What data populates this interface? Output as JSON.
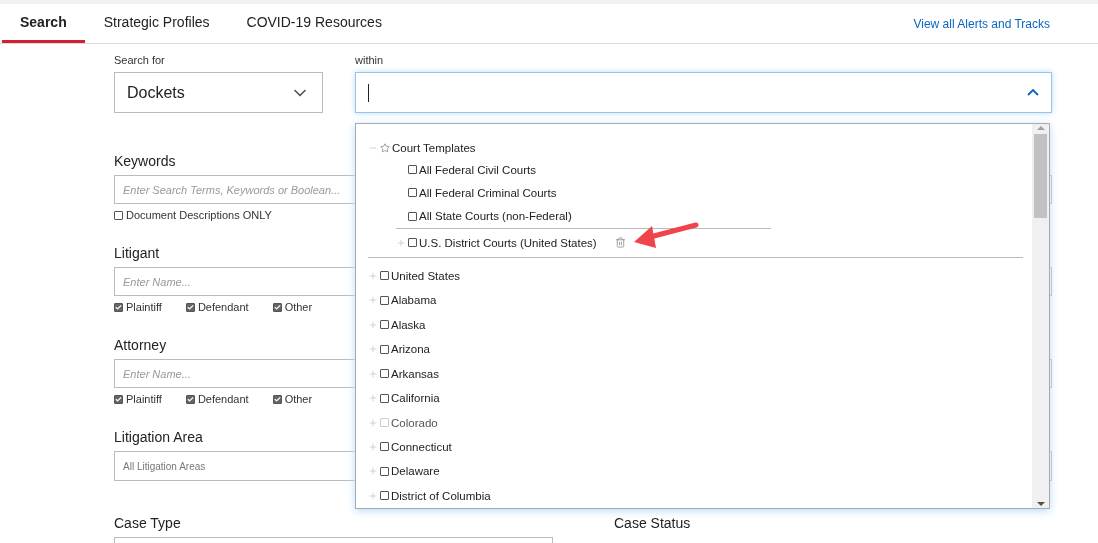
{
  "tabs": [
    {
      "label": "Search",
      "selected": true
    },
    {
      "label": "Strategic Profiles",
      "selected": false
    },
    {
      "label": "COVID-19 Resources",
      "selected": false
    }
  ],
  "alerts_link": "View all Alerts and Tracks",
  "search_for": {
    "label": "Search for",
    "value": "Dockets"
  },
  "within": {
    "label": "within",
    "expanded": true
  },
  "court_tree": {
    "templates": {
      "label": "Court Templates",
      "expanded": true,
      "children": [
        {
          "label": "All Federal Civil Courts",
          "checked": false
        },
        {
          "label": "All Federal Criminal Courts",
          "checked": false
        },
        {
          "label": "All State Courts (non-Federal)",
          "checked": false
        }
      ],
      "saved": [
        {
          "label": "U.S. District Courts (United States)",
          "checked": false,
          "expanded": false
        }
      ]
    },
    "jurisdictions": [
      {
        "label": "United States",
        "checked": false,
        "disabled": false,
        "expanded": false
      },
      {
        "label": "Alabama",
        "checked": false,
        "disabled": false,
        "expanded": false
      },
      {
        "label": "Alaska",
        "checked": false,
        "disabled": false,
        "expanded": false
      },
      {
        "label": "Arizona",
        "checked": false,
        "disabled": false,
        "expanded": false
      },
      {
        "label": "Arkansas",
        "checked": false,
        "disabled": false,
        "expanded": false
      },
      {
        "label": "California",
        "checked": false,
        "disabled": false,
        "expanded": false
      },
      {
        "label": "Colorado",
        "checked": false,
        "disabled": true,
        "expanded": false
      },
      {
        "label": "Connecticut",
        "checked": false,
        "disabled": false,
        "expanded": false
      },
      {
        "label": "Delaware",
        "checked": false,
        "disabled": false,
        "expanded": false
      },
      {
        "label": "District of Columbia",
        "checked": false,
        "disabled": false,
        "expanded": false
      }
    ]
  },
  "keywords": {
    "label": "Keywords",
    "placeholder": "Enter Search Terms, Keywords or Boolean...",
    "options": [
      {
        "label": "Document Descriptions ONLY",
        "checked": false
      }
    ]
  },
  "litigant": {
    "label": "Litigant",
    "placeholder": "Enter Name...",
    "options": [
      {
        "label": "Plaintiff",
        "checked": true
      },
      {
        "label": "Defendant",
        "checked": true
      },
      {
        "label": "Other",
        "checked": true
      }
    ]
  },
  "attorney": {
    "label": "Attorney",
    "placeholder": "Enter Name...",
    "options": [
      {
        "label": "Plaintiff",
        "checked": true
      },
      {
        "label": "Defendant",
        "checked": true
      },
      {
        "label": "Other",
        "checked": true
      }
    ]
  },
  "litigation_area": {
    "label": "Litigation Area",
    "value": "All Litigation Areas"
  },
  "case_type": {
    "label": "Case Type"
  },
  "case_status": {
    "label": "Case Status"
  }
}
